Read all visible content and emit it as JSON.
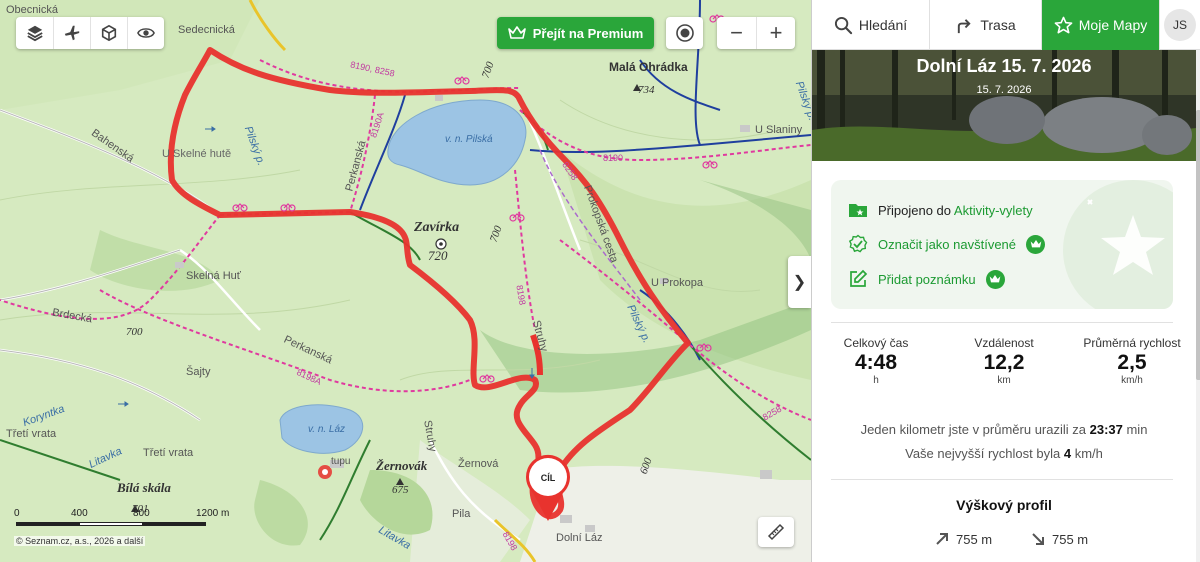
{
  "map": {
    "labels": {
      "obecnicka": "Obecnická",
      "sedecnicka": "Sedecnická",
      "mala_ohradka": "Malá Ohrádka",
      "alt_734": "734",
      "u_slaniny": "U Slaniny",
      "bahenska": "Bahenská",
      "u_skelne_hute": "U Skelné hutě",
      "pilsky_p1": "Pilský p.",
      "pilsky_p2": "Pilský p.",
      "pilsky_p3": "Pilský p.",
      "vn_pilska": "v. n. Pilská",
      "perkanska1": "Perkanská",
      "perkanska2": "Perkanská",
      "prokopska": "Prokopská cesta",
      "zavirka": "Zavírka",
      "alt_720": "720",
      "alt_700a": "700",
      "alt_700b": "700",
      "alt_700c": "700",
      "alt_600": "600",
      "skelna_hut": "Skelná Huť",
      "brdecka": "Brdecká",
      "sajty": "Šajty",
      "u_prokopa": "U Prokopa",
      "struhy1": "Struhy",
      "struhy2": "Struhy",
      "koryntka": "Koryntka",
      "tretivrata1": "Třetí vrata",
      "tretivrata2": "Třetí vrata",
      "litavka1": "Litavka",
      "litavka2": "Litavka",
      "vn_laz": "v. n. Láz",
      "bila_skala": "Bílá skála",
      "alt_701": "701",
      "zernovak": "Žernovák",
      "alt_675": "675",
      "zernova": "Žernová",
      "pila": "Pila",
      "dolni_laz": "Dolní Láz",
      "tupu": "tupu",
      "r_8190_8258": "8190, 8258",
      "r_8190a": "8190A",
      "r_8190": "8190",
      "r_8258a": "8258",
      "r_8198a": "8198A",
      "r_8198": "8198",
      "r_8198b": "8198",
      "r_8258b": "8258"
    },
    "premium_label": "Přejít na Premium",
    "zoom_out": "−",
    "zoom_in": "+",
    "cil_label": "CÍL",
    "scale": {
      "ticks": [
        "0",
        "400",
        "800",
        "1200"
      ],
      "unit": "m"
    },
    "copyright": "© Seznam.cz, a.s., 2026 a další",
    "collapse_icon": "❯",
    "colors": {
      "route": "#e8332e",
      "bike": "#e0399f",
      "water": "#9cc4e4",
      "blue_trail": "#1f3f9e",
      "premium": "#2aa63a"
    }
  },
  "panel": {
    "tabs": {
      "search": "Hledání",
      "route": "Trasa",
      "my_maps": "Moje Mapy",
      "avatar": "JS"
    },
    "title": "Dolní Láz 15. 7. 2026",
    "date": "15. 7. 2026",
    "actions": {
      "connected_prefix": "Připojeno do ",
      "connected_link": "Aktivity-vylety",
      "mark_visited": "Označit jako navštívené",
      "add_note": "Přidat poznámku"
    },
    "stats": [
      {
        "label": "Celkový čas",
        "value": "4:48",
        "unit": "h"
      },
      {
        "label": "Vzdálenost",
        "value": "12,2",
        "unit": "km"
      },
      {
        "label": "Průměrná rychlost",
        "value": "2,5",
        "unit": "km/h"
      }
    ],
    "pace": {
      "prefix": "Jeden kilometr jste v průměru urazili za ",
      "value": "23:37",
      "suffix": " min"
    },
    "max_speed": {
      "prefix": "Vaše nejvyšší rychlost byla ",
      "value": "4",
      "suffix": " km/h"
    },
    "profile_title": "Výškový profil",
    "ascent": "755 m",
    "descent": "755 m"
  }
}
